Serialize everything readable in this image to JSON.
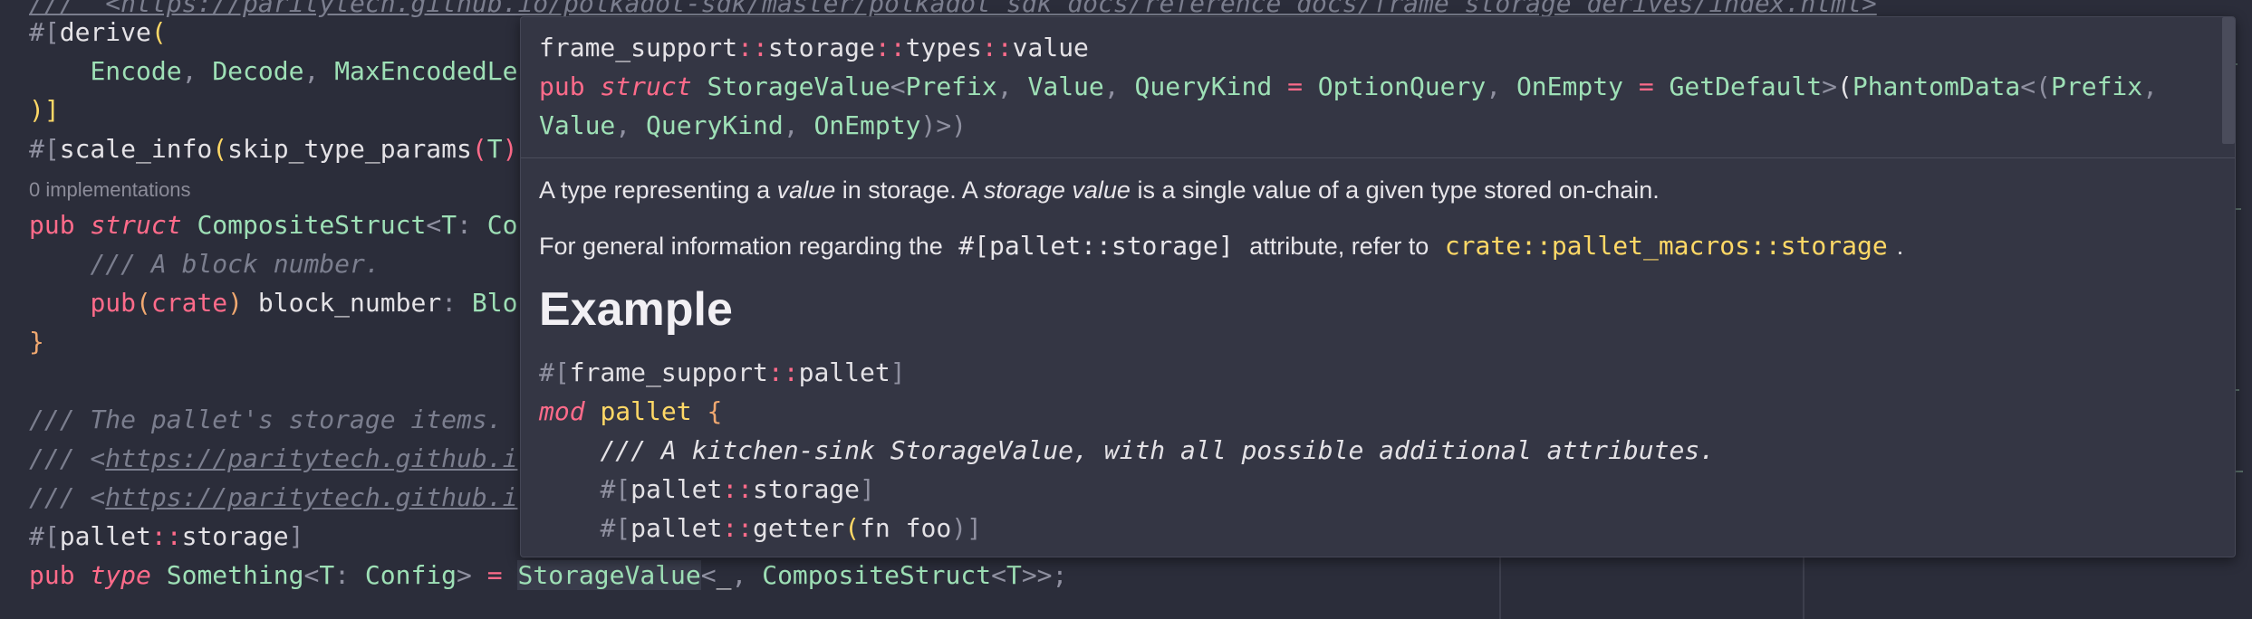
{
  "editor": {
    "line0": "///  <https://paritytech.github.io/polkadot-sdk/master/polkadot_sdk_docs/reference_docs/frame_storage_derives/index.html>",
    "line1": {
      "hash": "#[",
      "derive": "derive",
      "open": "("
    },
    "line2": {
      "a": "Encode",
      "b": "Decode",
      "c": "MaxEncodedLe"
    },
    "line3": ")]",
    "line4": {
      "hash": "#[",
      "scale": "scale_info",
      "open": "(",
      "skip": "skip_type_params",
      "open2": "(",
      "t": "T",
      "close": ")"
    },
    "codelens": "0 implementations",
    "line5": {
      "pub": "pub",
      "struct": "struct",
      "name": "CompositeStruct",
      "lt": "<",
      "t": "T",
      "colon": ":",
      "co": "Co"
    },
    "line6": "/// A block number.",
    "line7": {
      "pub": "pub",
      "crate": "crate",
      "field": "block_number",
      "colon": ":",
      "blo": "Blo"
    },
    "line8": "}",
    "line10": "/// The pallet's storage items.",
    "line11_prefix": "/// <",
    "line11_link": "https://paritytech.github.i",
    "line12_prefix": "/// <",
    "line12_link": "https://paritytech.github.i",
    "line13": {
      "hash": "#[",
      "pallet": "pallet",
      "sep": "::",
      "storage": "storage",
      "close": "]"
    },
    "line14": {
      "pub": "pub",
      "type": "type",
      "name": "Something",
      "lt": "<",
      "t": "T",
      "colon": ":",
      "config": "Config",
      "gt": ">",
      "eq": "=",
      "sv": "StorageValue",
      "lt2": "<",
      "us": "_",
      "comma": ",",
      "cs": "CompositeStruct",
      "lt3": "<",
      "t2": "T",
      "end": ">>;"
    }
  },
  "hover": {
    "path": {
      "a": "frame_support",
      "b": "storage",
      "c": "types",
      "d": "value",
      "sep": "::"
    },
    "sig1": {
      "pub": "pub",
      "struct": "struct",
      "name": "StorageValue",
      "lt": "<",
      "prefix": "Prefix",
      "value": "Value",
      "qk": "QueryKind",
      "eq": "=",
      "oq": "OptionQuery",
      "oe": "OnEmpty",
      "gd": "GetDefault",
      "gt": ">",
      "open": "(",
      "pd": "PhantomData",
      "lt2": "<(",
      "prefix2": "Prefix",
      "comma": ","
    },
    "sig2": {
      "value": "Value",
      "qk": "QueryKind",
      "oe": "OnEmpty",
      "close": ")>)"
    },
    "doc1": {
      "a": "A type representing a ",
      "b": "value",
      "c": " in storage. A ",
      "d": "storage value",
      "e": " is a single value of a given type stored on-chain."
    },
    "doc2": {
      "a": "For general information regarding the ",
      "code": "#[pallet::storage]",
      "b": " attribute, refer to ",
      "link": "crate::pallet_macros::storage",
      "c": "."
    },
    "heading": "Example",
    "ex1": {
      "hash": "#[",
      "fs": "frame_support",
      "sep": "::",
      "pallet": "pallet",
      "close": "]"
    },
    "ex2": {
      "mod": "mod",
      "name": "pallet",
      "brace": "{"
    },
    "ex3": "/// A kitchen-sink StorageValue, with all possible additional attributes.",
    "ex4": {
      "hash": "#[",
      "pallet": "pallet",
      "sep": "::",
      "storage": "storage",
      "close": "]"
    },
    "ex5": {
      "hash": "#[",
      "pallet": "pallet",
      "sep": "::",
      "getter": "getter",
      "open": "(",
      "fn": "fn",
      "foo": "foo",
      "close": ")]"
    }
  },
  "colors": {
    "background": "#2b2d3a",
    "hover_bg": "#343644",
    "keyword": "#ff6b8a",
    "type": "#9ee0b6",
    "link": "#ffd866",
    "comment": "#7b7e8e"
  }
}
